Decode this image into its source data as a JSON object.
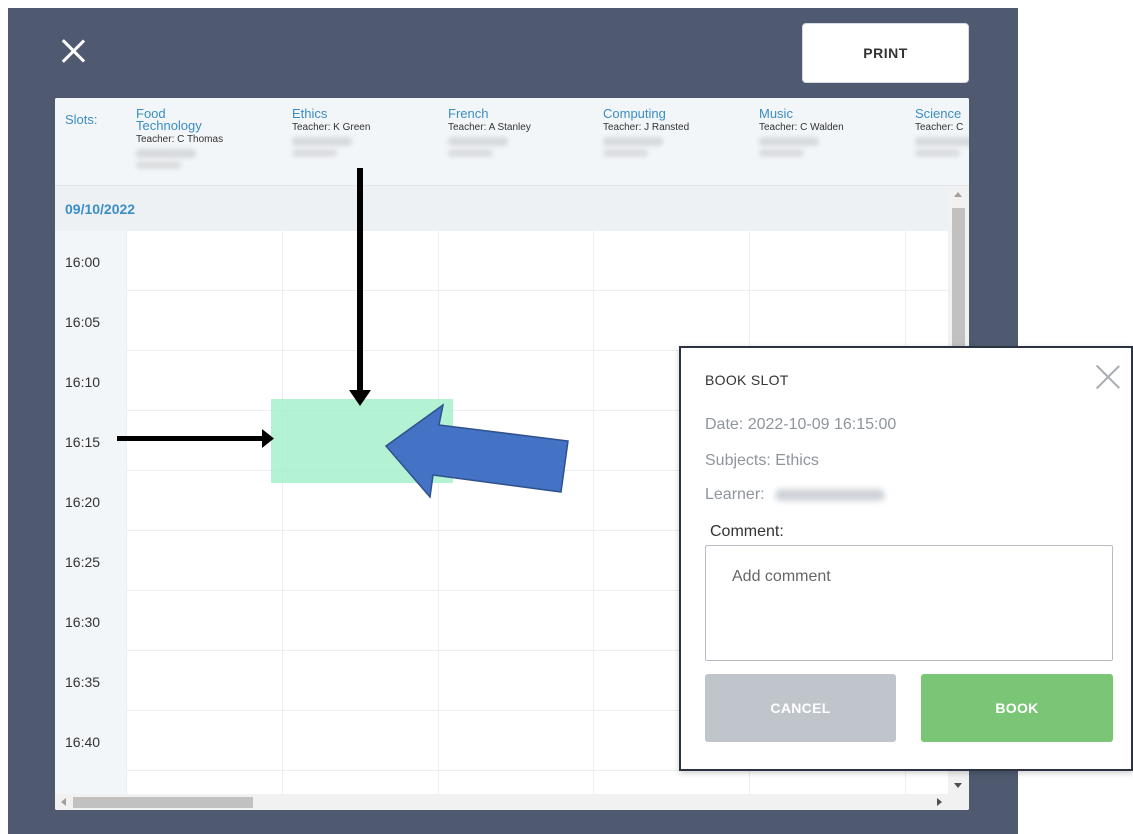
{
  "toolbar": {
    "print_label": "PRINT"
  },
  "schedule": {
    "slots_label": "Slots:",
    "columns": [
      {
        "subject": "Food\nTechnology",
        "teacher": "Teacher: C Thomas"
      },
      {
        "subject": "Ethics",
        "teacher": "Teacher: K Green"
      },
      {
        "subject": "French",
        "teacher": "Teacher: A Stanley"
      },
      {
        "subject": "Computing",
        "teacher": "Teacher: J Ransted"
      },
      {
        "subject": "Music",
        "teacher": "Teacher: C Walden"
      },
      {
        "subject": "Science",
        "teacher": "Teacher: C"
      }
    ],
    "date": "09/10/2022",
    "times": [
      "16:00",
      "16:05",
      "16:10",
      "16:15",
      "16:20",
      "16:25",
      "16:30",
      "16:35",
      "16:40"
    ]
  },
  "dialog": {
    "title": "BOOK SLOT",
    "date_line": "Date: 2022-10-09 16:15:00",
    "subjects_line": "Subjects: Ethics",
    "learner_label": "Learner:",
    "comment_label": "Comment:",
    "comment_placeholder": "Add comment",
    "comment_value": "",
    "cancel_label": "CANCEL",
    "book_label": "BOOK"
  },
  "colors": {
    "overlay": "#4f5a70",
    "accent_blue": "#3a8dc5",
    "highlight": "#a0f0c8",
    "book_button": "#7bc676",
    "cancel_button": "#c0c5cb",
    "annotation_arrow": "#4472c4"
  }
}
